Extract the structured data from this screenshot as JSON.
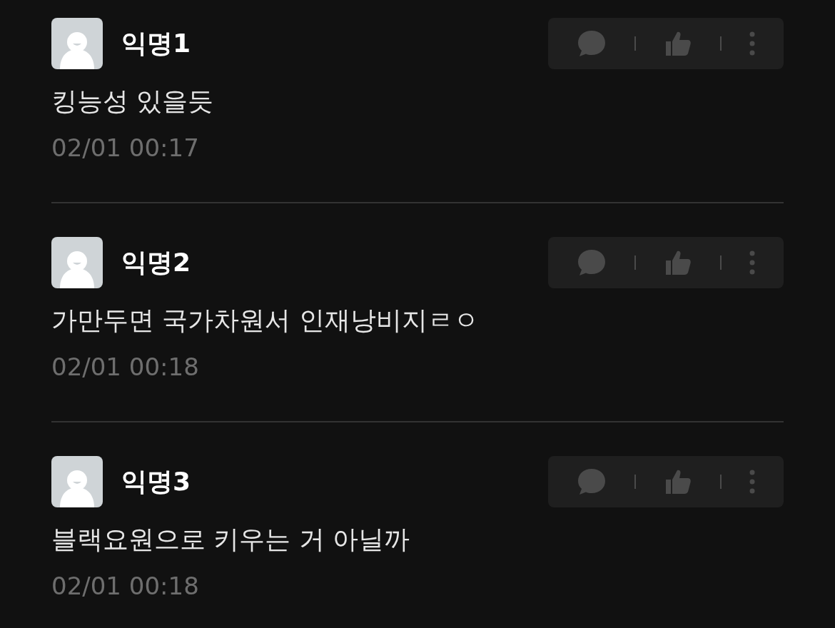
{
  "comments": [
    {
      "author": "익명1",
      "text": "킹능성 있을듯",
      "time": "02/01 00:17"
    },
    {
      "author": "익명2",
      "text": "가만두면 국가차원서 인재낭비지ㄹㅇ",
      "time": "02/01 00:18"
    },
    {
      "author": "익명3",
      "text": "블랙요원으로 키우는 거 아닐까",
      "time": "02/01 00:18"
    }
  ]
}
